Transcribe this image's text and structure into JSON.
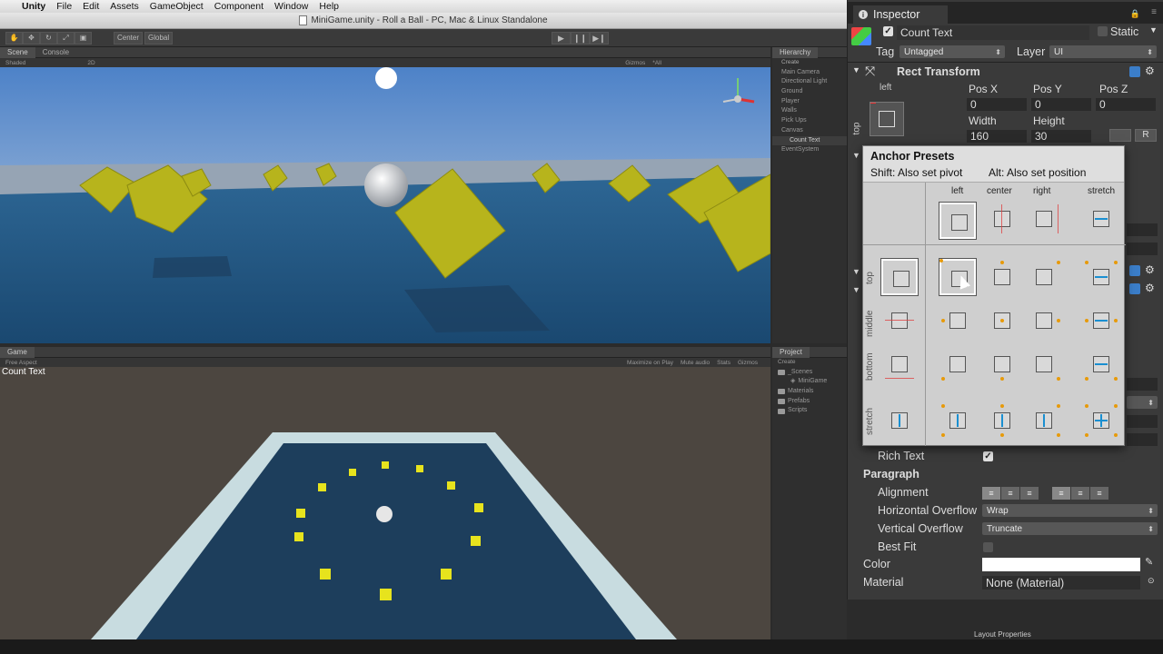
{
  "menubar": {
    "apple": "",
    "app": "Unity",
    "items": [
      "File",
      "Edit",
      "Assets",
      "GameObject",
      "Component",
      "Window",
      "Help"
    ]
  },
  "titlebar": {
    "title": "MiniGame.unity - Roll a Ball - PC, Mac & Linux Standalone"
  },
  "toolbar": {
    "center": "Center",
    "global": "Global",
    "play": "▶",
    "pause": "❙❙",
    "step": "▶❙"
  },
  "scene_panel": {
    "tabs": [
      "Scene",
      "Console"
    ],
    "sub": [
      "Shaded",
      "2D"
    ],
    "gizmos": "Gizmos",
    "search": "*All"
  },
  "hierarchy": {
    "tab": "Hierarchy",
    "create": "Create",
    "items": [
      "Main Camera",
      "Directional Light",
      "Ground",
      "Player",
      "Walls",
      "Pick Ups",
      "Canvas",
      "Count Text",
      "EventSystem"
    ]
  },
  "game_panel": {
    "tab": "Game",
    "aspect": "Free Aspect",
    "right": [
      "Maximize on Play",
      "Mute audio",
      "Stats",
      "Gizmos"
    ],
    "count_text": "Count Text"
  },
  "project": {
    "tab": "Project",
    "create": "Create",
    "items": [
      "_Scenes",
      "MiniGame",
      "Materials",
      "Prefabs",
      "Scripts"
    ]
  },
  "inspector": {
    "tab": "Inspector",
    "object_name": "Count Text",
    "static_label": "Static",
    "tag_label": "Tag",
    "tag_value": "Untagged",
    "layer_label": "Layer",
    "layer_value": "UI",
    "rect_transform": "Rect Transform",
    "anchor_h": "left",
    "anchor_v": "top",
    "pos_x_label": "Pos X",
    "pos_y_label": "Pos Y",
    "pos_z_label": "Pos Z",
    "pos_x": "0",
    "pos_y": "0",
    "pos_z": "0",
    "width_label": "Width",
    "height_label": "Height",
    "width": "160",
    "height": "30",
    "r_button": "R",
    "rich_text": "Rich Text",
    "paragraph": "Paragraph",
    "alignment": "Alignment",
    "h_overflow": "Horizontal Overflow",
    "h_overflow_value": "Wrap",
    "v_overflow": "Vertical Overflow",
    "v_overflow_value": "Truncate",
    "best_fit": "Best Fit",
    "color": "Color",
    "material": "Material",
    "material_value": "None (Material)",
    "layout_properties": "Layout Properties"
  },
  "anchor_presets": {
    "title": "Anchor Presets",
    "shift": "Shift: Also set pivot",
    "alt": "Alt: Also set position",
    "columns": [
      "left",
      "center",
      "right",
      "stretch"
    ],
    "rows": [
      "top",
      "middle",
      "bottom",
      "stretch"
    ]
  }
}
